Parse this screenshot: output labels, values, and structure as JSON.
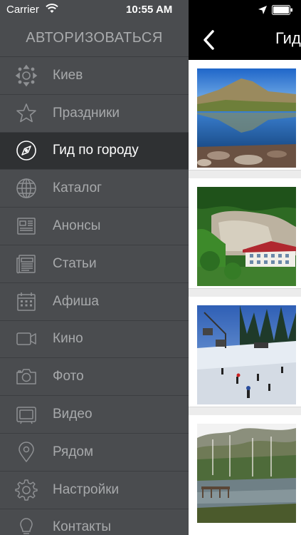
{
  "status_bar": {
    "carrier": "Carrier",
    "time": "10:55 AM"
  },
  "menu": {
    "auth_label": "АВТОРИЗОВАТЬСЯ",
    "items": [
      {
        "label": "Киев",
        "icon": "location-target-icon"
      },
      {
        "label": "Праздники",
        "icon": "star-icon"
      },
      {
        "label": "Гид по городу",
        "icon": "compass-icon",
        "active": true
      },
      {
        "label": "Каталог",
        "icon": "globe-icon"
      },
      {
        "label": "Анонсы",
        "icon": "newspaper-icon"
      },
      {
        "label": "Статьи",
        "icon": "articles-icon"
      },
      {
        "label": "Афиша",
        "icon": "calendar-icon"
      },
      {
        "label": "Кино",
        "icon": "video-camera-icon"
      },
      {
        "label": "Фото",
        "icon": "photo-camera-icon"
      },
      {
        "label": "Видео",
        "icon": "tv-icon"
      },
      {
        "label": "Рядом",
        "icon": "map-pin-icon"
      },
      {
        "label": "Настройки",
        "icon": "gear-icon"
      },
      {
        "label": "Контакты",
        "icon": "lightbulb-icon"
      }
    ]
  },
  "content": {
    "nav_title": "Гид",
    "cards": [
      {
        "image": "mountain-lake-photo"
      },
      {
        "image": "forest-cliff-hotel-photo"
      },
      {
        "image": "ski-slope-photo"
      },
      {
        "image": "forest-river-photo"
      }
    ]
  },
  "colors": {
    "menu_bg": "#4a4c4f",
    "menu_active_bg": "#2f3133",
    "menu_text": "#a7a9ab",
    "navbar_bg": "#000000"
  }
}
